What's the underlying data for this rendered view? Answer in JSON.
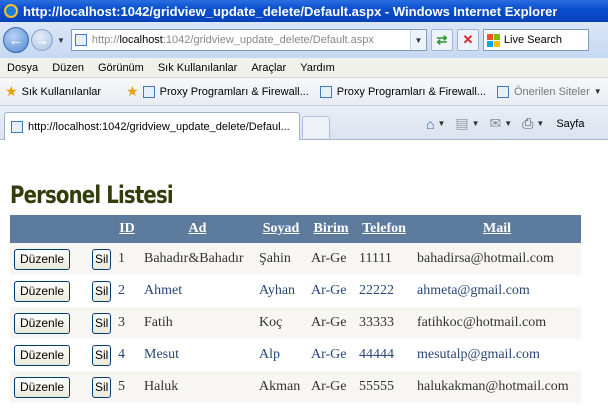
{
  "window": {
    "title": "http://localhost:1042/gridview_update_delete/Default.aspx - Windows Internet Explorer"
  },
  "addressbar": {
    "url_prefix": "http://",
    "url_host": "localhost",
    "url_rest": ":1042/gridview_update_delete/Default.aspx",
    "search_placeholder": "Live Search"
  },
  "menu": [
    "Dosya",
    "Düzen",
    "Görünüm",
    "Sık Kullanılanlar",
    "Araçlar",
    "Yardım"
  ],
  "favorites": {
    "label": "Sık Kullanılanlar",
    "items": [
      "Proxy Programları & Firewall...",
      "Proxy Programları & Firewall..."
    ],
    "suggested": "Önerilen Siteler"
  },
  "tab": {
    "title": "http://localhost:1042/gridview_update_delete/Defaul..."
  },
  "toolbar": {
    "page_label": "Sayfa"
  },
  "page": {
    "title": "Personel Listesi",
    "grid": {
      "headers": [
        "ID",
        "Ad",
        "Soyad",
        "Birim",
        "Telefon",
        "Mail"
      ],
      "edit_label": "Düzenle",
      "delete_label": "Sil",
      "rows": [
        [
          "1",
          "Bahadır&Bahadır",
          "Şahin",
          "Ar-Ge",
          "11111",
          "bahadirsa@hotmail.com"
        ],
        [
          "2",
          "Ahmet",
          "Ayhan",
          "Ar-Ge",
          "22222",
          "ahmeta@gmail.com"
        ],
        [
          "3",
          "Fatih",
          "Koç",
          "Ar-Ge",
          "33333",
          "fatihkoc@hotmail.com"
        ],
        [
          "4",
          "Mesut",
          "Alp",
          "Ar-Ge",
          "44444",
          "mesutalp@gmail.com"
        ],
        [
          "5",
          "Haluk",
          "Akman",
          "Ar-Ge",
          "55555",
          "halukakman@hotmail.com"
        ]
      ]
    }
  },
  "colors": {
    "header_bg": "#5d7b9d",
    "row_odd": "#f7f6f3",
    "row_even_text": "#284775",
    "title_color": "#313e0c"
  }
}
